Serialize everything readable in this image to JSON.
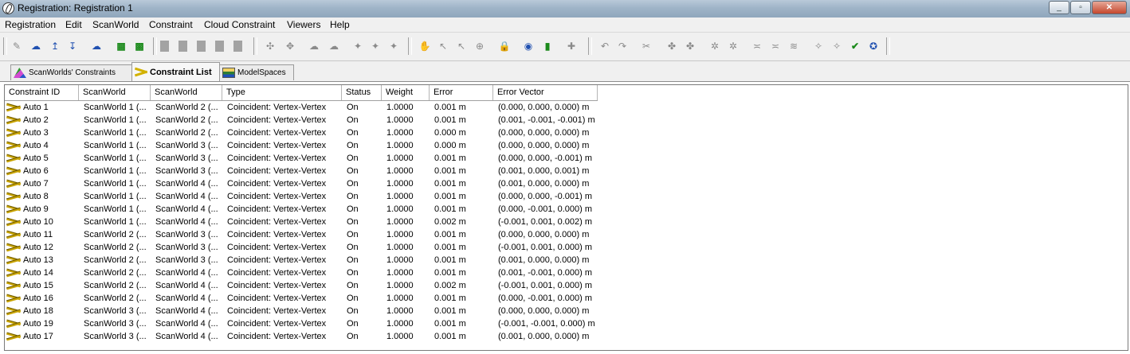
{
  "window": {
    "title": "Registration: Registration 1",
    "controls": [
      "_",
      "▫",
      "✕"
    ]
  },
  "menu": [
    "Registration",
    "Edit",
    "ScanWorld",
    "Constraint",
    "Cloud Constraint",
    "Viewers",
    "Help"
  ],
  "toolbar": {
    "icons": [
      "import-scan-icon",
      "scan-cloud-icon",
      "scan-up-icon",
      "scan-down-icon",
      "scan-refresh-icon",
      "grid-select-icon",
      "grid-dots-icon",
      "placeholder-1",
      "placeholder-2",
      "placeholder-3",
      "placeholder-4",
      "placeholder-5",
      "add-constraint-icon",
      "remove-constraint-icon",
      "cloud-icon",
      "cloud-info-icon",
      "constraint-a-icon",
      "constraint-b-icon",
      "constraint-c-icon",
      "pan-icon",
      "select-icon",
      "select-add-icon",
      "target-icon",
      "lock-icon",
      "globe-icon",
      "camera-icon",
      "plus-icon",
      "undo-icon",
      "redo-icon",
      "cut-icon",
      "join-a-icon",
      "join-b-icon",
      "auto-a-icon",
      "auto-b-icon",
      "line-a-icon",
      "line-b-icon",
      "line-c-icon",
      "wand-a-icon",
      "wand-b-icon",
      "wand-c-icon",
      "wand-d-icon"
    ]
  },
  "tabs": [
    {
      "label": "ScanWorlds' Constraints",
      "icon": "scanworld-icon"
    },
    {
      "label": "Constraint List",
      "icon": "constraint-icon"
    },
    {
      "label": "ModelSpaces",
      "icon": "modelspace-icon"
    }
  ],
  "table": {
    "columns": [
      "Constraint ID",
      "ScanWorld",
      "ScanWorld",
      "Type",
      "Status",
      "Weight",
      "Error",
      "Error Vector"
    ],
    "rows": [
      [
        "Auto 1",
        "ScanWorld 1 (...",
        "ScanWorld 2 (...",
        "Coincident: Vertex-Vertex",
        "On",
        "1.0000",
        "0.001 m",
        "(0.000, 0.000, 0.000) m"
      ],
      [
        "Auto 2",
        "ScanWorld 1 (...",
        "ScanWorld 2 (...",
        "Coincident: Vertex-Vertex",
        "On",
        "1.0000",
        "0.001 m",
        "(0.001, -0.001, -0.001) m"
      ],
      [
        "Auto 3",
        "ScanWorld 1 (...",
        "ScanWorld 2 (...",
        "Coincident: Vertex-Vertex",
        "On",
        "1.0000",
        "0.000 m",
        "(0.000, 0.000, 0.000) m"
      ],
      [
        "Auto 4",
        "ScanWorld 1 (...",
        "ScanWorld 3 (...",
        "Coincident: Vertex-Vertex",
        "On",
        "1.0000",
        "0.000 m",
        "(0.000, 0.000, 0.000) m"
      ],
      [
        "Auto 5",
        "ScanWorld 1 (...",
        "ScanWorld 3 (...",
        "Coincident: Vertex-Vertex",
        "On",
        "1.0000",
        "0.001 m",
        "(0.000, 0.000, -0.001) m"
      ],
      [
        "Auto 6",
        "ScanWorld 1 (...",
        "ScanWorld 3 (...",
        "Coincident: Vertex-Vertex",
        "On",
        "1.0000",
        "0.001 m",
        "(0.001, 0.000, 0.001) m"
      ],
      [
        "Auto 7",
        "ScanWorld 1 (...",
        "ScanWorld 4 (...",
        "Coincident: Vertex-Vertex",
        "On",
        "1.0000",
        "0.001 m",
        "(0.001, 0.000, 0.000) m"
      ],
      [
        "Auto 8",
        "ScanWorld 1 (...",
        "ScanWorld 4 (...",
        "Coincident: Vertex-Vertex",
        "On",
        "1.0000",
        "0.001 m",
        "(0.000, 0.000, -0.001) m"
      ],
      [
        "Auto 9",
        "ScanWorld 1 (...",
        "ScanWorld 4 (...",
        "Coincident: Vertex-Vertex",
        "On",
        "1.0000",
        "0.001 m",
        "(0.000, -0.001, 0.000) m"
      ],
      [
        "Auto 10",
        "ScanWorld 1 (...",
        "ScanWorld 4 (...",
        "Coincident: Vertex-Vertex",
        "On",
        "1.0000",
        "0.002 m",
        "(-0.001, 0.001, 0.002) m"
      ],
      [
        "Auto 11",
        "ScanWorld 2 (...",
        "ScanWorld 3 (...",
        "Coincident: Vertex-Vertex",
        "On",
        "1.0000",
        "0.001 m",
        "(0.000, 0.000, 0.000) m"
      ],
      [
        "Auto 12",
        "ScanWorld 2 (...",
        "ScanWorld 3 (...",
        "Coincident: Vertex-Vertex",
        "On",
        "1.0000",
        "0.001 m",
        "(-0.001, 0.001, 0.000) m"
      ],
      [
        "Auto 13",
        "ScanWorld 2 (...",
        "ScanWorld 3 (...",
        "Coincident: Vertex-Vertex",
        "On",
        "1.0000",
        "0.001 m",
        "(0.001, 0.000, 0.000) m"
      ],
      [
        "Auto 14",
        "ScanWorld 2 (...",
        "ScanWorld 4 (...",
        "Coincident: Vertex-Vertex",
        "On",
        "1.0000",
        "0.001 m",
        "(0.001, -0.001, 0.000) m"
      ],
      [
        "Auto 15",
        "ScanWorld 2 (...",
        "ScanWorld 4 (...",
        "Coincident: Vertex-Vertex",
        "On",
        "1.0000",
        "0.002 m",
        "(-0.001, 0.001, 0.000) m"
      ],
      [
        "Auto 16",
        "ScanWorld 2 (...",
        "ScanWorld 4 (...",
        "Coincident: Vertex-Vertex",
        "On",
        "1.0000",
        "0.001 m",
        "(0.000, -0.001, 0.000) m"
      ],
      [
        "Auto 18",
        "ScanWorld 3 (...",
        "ScanWorld 4 (...",
        "Coincident: Vertex-Vertex",
        "On",
        "1.0000",
        "0.001 m",
        "(0.000, 0.000, 0.000) m"
      ],
      [
        "Auto 19",
        "ScanWorld 3 (...",
        "ScanWorld 4 (...",
        "Coincident: Vertex-Vertex",
        "On",
        "1.0000",
        "0.001 m",
        "(-0.001, -0.001, 0.000) m"
      ],
      [
        "Auto 17",
        "ScanWorld 3 (...",
        "ScanWorld 4 (...",
        "Coincident: Vertex-Vertex",
        "On",
        "1.0000",
        "0.001 m",
        "(0.001, 0.000, 0.000) m"
      ]
    ]
  }
}
